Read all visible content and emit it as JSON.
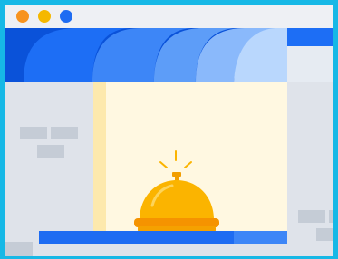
{
  "window": {
    "traffic_lights": [
      {
        "name": "close",
        "color": "#f7931e"
      },
      {
        "name": "minimize",
        "color": "#f5b800"
      },
      {
        "name": "maximize",
        "color": "#1e6cf2"
      }
    ]
  },
  "illustration": {
    "subject": "service-bell-icon",
    "colors": {
      "awning_dark": "#0a52d9",
      "awning_stripes": [
        "#1d6ef5",
        "#3d86f7",
        "#5d9df8",
        "#8ab9fb",
        "#b9d7fd"
      ],
      "window_fill": "#fff8e1",
      "wall": "#dfe3ea",
      "brick": "#c5ccd6",
      "bell": "#fbb400",
      "counter": "#1e6cf2"
    }
  }
}
